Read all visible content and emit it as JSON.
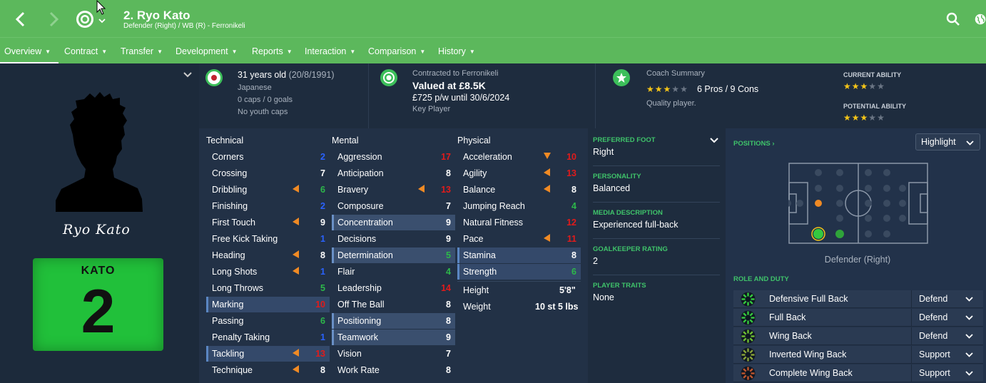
{
  "header": {
    "title": "2. Ryo Kato",
    "subtitle": "Defender (Right) / WB (R) - Ferronikeli"
  },
  "nav": [
    {
      "label": "Overview"
    },
    {
      "label": "Contract"
    },
    {
      "label": "Transfer"
    },
    {
      "label": "Development"
    },
    {
      "label": "Reports"
    },
    {
      "label": "Interaction"
    },
    {
      "label": "Comparison"
    },
    {
      "label": "History"
    }
  ],
  "profile": {
    "signature": "Ryo Kato",
    "shirt_name": "KATO",
    "shirt_number": "2"
  },
  "info": {
    "age": "31 years old",
    "dob": "(20/8/1991)",
    "nationality": "Japanese",
    "caps": "0 caps / 0 goals",
    "youth": "No youth caps",
    "contract_to": "Contracted to Ferronikeli",
    "valued": "Valued at £8.5K",
    "wage": "£725 p/w until 30/6/2024",
    "status": "Key Player",
    "coach_title": "Coach Summary",
    "coach_stars": 3,
    "coach_pros_cons": "6 Pros / 9 Cons",
    "coach_quality": "Quality player.",
    "current_ability_label": "CURRENT ABILITY",
    "current_ability_stars": 3,
    "potential_ability_label": "POTENTIAL ABILITY",
    "potential_ability_stars": 3
  },
  "attributes": {
    "technical_title": "Technical",
    "mental_title": "Mental",
    "physical_title": "Physical",
    "technical": [
      {
        "name": "Corners",
        "value": "2",
        "color": "b"
      },
      {
        "name": "Crossing",
        "value": "7",
        "color": "w"
      },
      {
        "name": "Dribbling",
        "value": "6",
        "color": "g",
        "arrow": "up"
      },
      {
        "name": "Finishing",
        "value": "2",
        "color": "b"
      },
      {
        "name": "First Touch",
        "value": "9",
        "color": "w",
        "arrow": "up"
      },
      {
        "name": "Free Kick Taking",
        "value": "1",
        "color": "b"
      },
      {
        "name": "Heading",
        "value": "8",
        "color": "w",
        "arrow": "up"
      },
      {
        "name": "Long Shots",
        "value": "1",
        "color": "b",
        "arrow": "up"
      },
      {
        "name": "Long Throws",
        "value": "5",
        "color": "g"
      },
      {
        "name": "Marking",
        "value": "10",
        "color": "r",
        "hl": true
      },
      {
        "name": "Passing",
        "value": "6",
        "color": "g"
      },
      {
        "name": "Penalty Taking",
        "value": "1",
        "color": "b"
      },
      {
        "name": "Tackling",
        "value": "13",
        "color": "r",
        "arrow": "up",
        "hl": true
      },
      {
        "name": "Technique",
        "value": "8",
        "color": "w",
        "arrow": "up"
      }
    ],
    "mental": [
      {
        "name": "Aggression",
        "value": "17",
        "color": "r"
      },
      {
        "name": "Anticipation",
        "value": "8",
        "color": "w"
      },
      {
        "name": "Bravery",
        "value": "13",
        "color": "r",
        "arrow": "up"
      },
      {
        "name": "Composure",
        "value": "7",
        "color": "w"
      },
      {
        "name": "Concentration",
        "value": "9",
        "color": "w",
        "hl2": true
      },
      {
        "name": "Decisions",
        "value": "9",
        "color": "w"
      },
      {
        "name": "Determination",
        "value": "5",
        "color": "g",
        "hl2": true
      },
      {
        "name": "Flair",
        "value": "4",
        "color": "g"
      },
      {
        "name": "Leadership",
        "value": "14",
        "color": "r"
      },
      {
        "name": "Off The Ball",
        "value": "8",
        "color": "w"
      },
      {
        "name": "Positioning",
        "value": "8",
        "color": "w",
        "hl2": true
      },
      {
        "name": "Teamwork",
        "value": "9",
        "color": "w",
        "hl2": true
      },
      {
        "name": "Vision",
        "value": "7",
        "color": "w"
      },
      {
        "name": "Work Rate",
        "value": "8",
        "color": "w"
      }
    ],
    "physical": [
      {
        "name": "Acceleration",
        "value": "10",
        "color": "r",
        "arrow": "down"
      },
      {
        "name": "Agility",
        "value": "13",
        "color": "r",
        "arrow": "up"
      },
      {
        "name": "Balance",
        "value": "8",
        "color": "w",
        "arrow": "up"
      },
      {
        "name": "Jumping Reach",
        "value": "4",
        "color": "g"
      },
      {
        "name": "Natural Fitness",
        "value": "12",
        "color": "r"
      },
      {
        "name": "Pace",
        "value": "11",
        "color": "r",
        "arrow": "up"
      },
      {
        "name": "Stamina",
        "value": "8",
        "color": "w",
        "hl": true
      },
      {
        "name": "Strength",
        "value": "6",
        "color": "g",
        "hl": true
      }
    ],
    "height_label": "Height",
    "height": "5'8\"",
    "weight_label": "Weight",
    "weight": "10 st 5 lbs"
  },
  "details": {
    "preferred_foot_label": "PREFERRED FOOT",
    "preferred_foot": "Right",
    "personality_label": "PERSONALITY",
    "personality": "Balanced",
    "media_label": "MEDIA DESCRIPTION",
    "media": "Experienced full-back",
    "gk_label": "GOALKEEPER RATING",
    "gk": "2",
    "traits_label": "PLAYER TRAITS",
    "traits": "None"
  },
  "positions": {
    "label": "POSITIONS",
    "highlight_label": "Highlight",
    "position_name": "Defender (Right)",
    "role_label": "ROLE AND DUTY",
    "roles": [
      {
        "name": "Defensive Full Back",
        "duty": "Defend",
        "color": "#35c93f"
      },
      {
        "name": "Full Back",
        "duty": "Defend",
        "color": "#35c93f"
      },
      {
        "name": "Wing Back",
        "duty": "Defend",
        "color": "#6dbd33"
      },
      {
        "name": "Inverted Wing Back",
        "duty": "Support",
        "color": "#8aa53a"
      },
      {
        "name": "Complete Wing Back",
        "duty": "Support",
        "color": "#c0562f"
      }
    ]
  },
  "colors": {
    "brand": "#5cb85c",
    "accent_green": "#3fc36a",
    "high": "#e11b1b",
    "low": "#2a62ff",
    "mid": "#2db84a",
    "star": "#f5c518"
  }
}
